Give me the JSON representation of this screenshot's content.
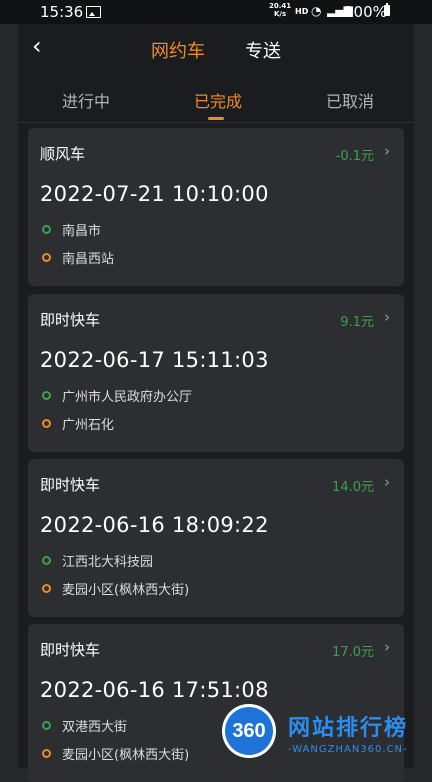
{
  "status_bar": {
    "time": "15:36",
    "net_speed_value": "20.41",
    "net_speed_unit": "K/s",
    "hd": "HD",
    "signal": "4G",
    "battery": "100%"
  },
  "nav": {
    "back_icon": "chevron-left-icon",
    "tabs": [
      {
        "label": "网约车",
        "active": true
      },
      {
        "label": "专送",
        "active": false
      }
    ]
  },
  "sub_tabs": [
    {
      "label": "进行中"
    },
    {
      "label": "已完成",
      "active": true
    },
    {
      "label": "已取消"
    }
  ],
  "colors": {
    "accent": "#f08c26",
    "price": "#3fa14a",
    "card_bg": "#2d2e32",
    "frame_bg": "#1b1c1f"
  },
  "orders": [
    {
      "type": "顺风车",
      "price": "-0.1元",
      "time": "2022-07-21 10:10:00",
      "start": "南昌市",
      "end": "南昌西站"
    },
    {
      "type": "即时快车",
      "price": "9.1元",
      "time": "2022-06-17 15:11:03",
      "start": "广州市人民政府办公厅",
      "end": "广州石化"
    },
    {
      "type": "即时快车",
      "price": "14.0元",
      "time": "2022-06-16 18:09:22",
      "start": "江西北大科技园",
      "end": "麦园小区(枫林西大街)"
    },
    {
      "type": "即时快车",
      "price": "17.0元",
      "time": "2022-06-16 17:51:08",
      "start": "双港西大街",
      "end": "麦园小区(枫林西大街)"
    }
  ],
  "watermark": {
    "badge": "360",
    "title": "网站排行榜",
    "sub": "-WANGZHAN360.CN-"
  }
}
